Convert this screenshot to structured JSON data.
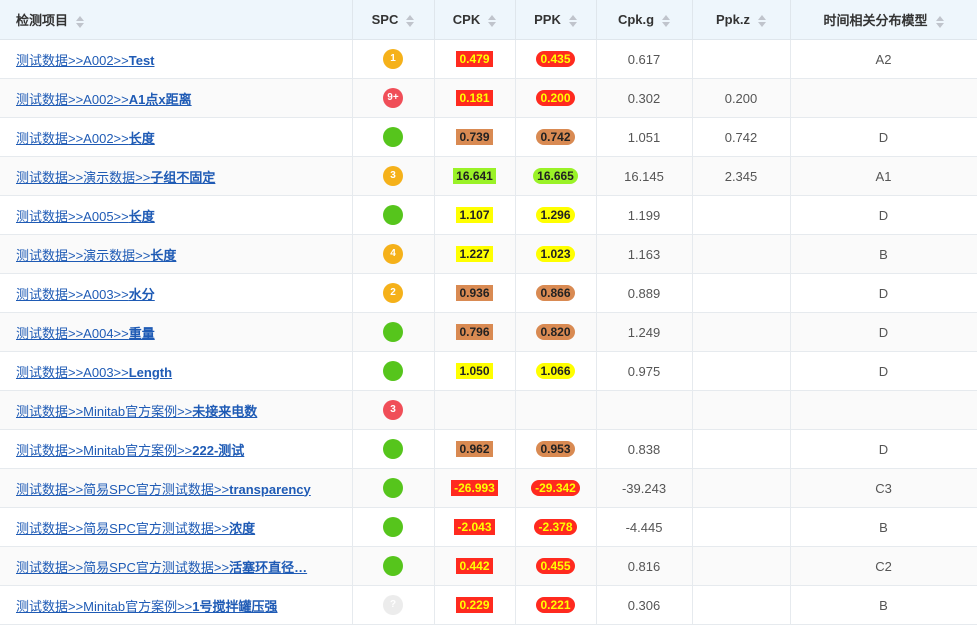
{
  "colors": {
    "red": "#ff2a1f",
    "orange": "#d98a52",
    "yellow": "#ffff00",
    "green": "#9af227",
    "dot_orange": "#f5b11a",
    "dot_red": "#f04e58",
    "dot_green": "#56c51c",
    "dot_gray": "#ececec"
  },
  "headers": [
    "检测项目",
    "SPC",
    "CPK",
    "PPK",
    "Cpk.g",
    "Ppk.z",
    "时间相关分布模型"
  ],
  "rows": [
    {
      "prefix": "测试数据>>A002>>",
      "bold": "Test",
      "spc": {
        "kind": "orange",
        "label": "1"
      },
      "cpk": {
        "v": "0.479",
        "c": "red"
      },
      "ppk": {
        "v": "0.435",
        "c": "red"
      },
      "cpkg": "0.617",
      "ppkz": "",
      "model": "A2"
    },
    {
      "prefix": "测试数据>>A002>>",
      "bold": "A1点x距离",
      "spc": {
        "kind": "red",
        "label": "9+"
      },
      "cpk": {
        "v": "0.181",
        "c": "red"
      },
      "ppk": {
        "v": "0.200",
        "c": "red"
      },
      "cpkg": "0.302",
      "ppkz": "0.200",
      "model": ""
    },
    {
      "prefix": "测试数据>>A002>>",
      "bold": "长度",
      "spc": {
        "kind": "green",
        "label": ""
      },
      "cpk": {
        "v": "0.739",
        "c": "orange"
      },
      "ppk": {
        "v": "0.742",
        "c": "orange"
      },
      "cpkg": "1.051",
      "ppkz": "0.742",
      "model": "D"
    },
    {
      "prefix": "测试数据>>演示数据>>",
      "bold": "子组不固定",
      "spc": {
        "kind": "orange",
        "label": "3"
      },
      "cpk": {
        "v": "16.641",
        "c": "green"
      },
      "ppk": {
        "v": "16.665",
        "c": "green"
      },
      "cpkg": "16.145",
      "ppkz": "2.345",
      "model": "A1"
    },
    {
      "prefix": "测试数据>>A005>>",
      "bold": "长度",
      "spc": {
        "kind": "green",
        "label": ""
      },
      "cpk": {
        "v": "1.107",
        "c": "yellow"
      },
      "ppk": {
        "v": "1.296",
        "c": "yellow"
      },
      "cpkg": "1.199",
      "ppkz": "",
      "model": "D"
    },
    {
      "prefix": "测试数据>>演示数据>>",
      "bold": "长度",
      "spc": {
        "kind": "orange",
        "label": "4"
      },
      "cpk": {
        "v": "1.227",
        "c": "yellow"
      },
      "ppk": {
        "v": "1.023",
        "c": "yellow"
      },
      "cpkg": "1.163",
      "ppkz": "",
      "model": "B"
    },
    {
      "prefix": "测试数据>>A003>>",
      "bold": "水分",
      "spc": {
        "kind": "orange",
        "label": "2"
      },
      "cpk": {
        "v": "0.936",
        "c": "orange"
      },
      "ppk": {
        "v": "0.866",
        "c": "orange"
      },
      "cpkg": "0.889",
      "ppkz": "",
      "model": "D"
    },
    {
      "prefix": "测试数据>>A004>>",
      "bold": "重量",
      "spc": {
        "kind": "green",
        "label": ""
      },
      "cpk": {
        "v": "0.796",
        "c": "orange"
      },
      "ppk": {
        "v": "0.820",
        "c": "orange"
      },
      "cpkg": "1.249",
      "ppkz": "",
      "model": "D"
    },
    {
      "prefix": "测试数据>>A003>>",
      "bold": "Length",
      "spc": {
        "kind": "green",
        "label": ""
      },
      "cpk": {
        "v": "1.050",
        "c": "yellow"
      },
      "ppk": {
        "v": "1.066",
        "c": "yellow"
      },
      "cpkg": "0.975",
      "ppkz": "",
      "model": "D"
    },
    {
      "prefix": "测试数据>>Minitab官方案例>>",
      "bold": "未接来电数",
      "spc": {
        "kind": "red",
        "label": "3"
      },
      "cpk": {
        "v": "",
        "c": ""
      },
      "ppk": {
        "v": "",
        "c": ""
      },
      "cpkg": "",
      "ppkz": "",
      "model": ""
    },
    {
      "prefix": "测试数据>>Minitab官方案例>>",
      "bold": "222-测试",
      "spc": {
        "kind": "green",
        "label": ""
      },
      "cpk": {
        "v": "0.962",
        "c": "orange"
      },
      "ppk": {
        "v": "0.953",
        "c": "orange"
      },
      "cpkg": "0.838",
      "ppkz": "",
      "model": "D"
    },
    {
      "prefix": "测试数据>>简易SPC官方测试数据>>",
      "bold": "transparency",
      "spc": {
        "kind": "green",
        "label": ""
      },
      "cpk": {
        "v": "-26.993",
        "c": "red"
      },
      "ppk": {
        "v": "-29.342",
        "c": "red"
      },
      "cpkg": "-39.243",
      "ppkz": "",
      "model": "C3"
    },
    {
      "prefix": "测试数据>>简易SPC官方测试数据>>",
      "bold": "浓度",
      "spc": {
        "kind": "green",
        "label": ""
      },
      "cpk": {
        "v": "-2.043",
        "c": "red"
      },
      "ppk": {
        "v": "-2.378",
        "c": "red"
      },
      "cpkg": "-4.445",
      "ppkz": "",
      "model": "B"
    },
    {
      "prefix": "测试数据>>简易SPC官方测试数据>>",
      "bold": "活塞环直径…",
      "spc": {
        "kind": "green",
        "label": ""
      },
      "cpk": {
        "v": "0.442",
        "c": "red"
      },
      "ppk": {
        "v": "0.455",
        "c": "red"
      },
      "cpkg": "0.816",
      "ppkz": "",
      "model": "C2"
    },
    {
      "prefix": "测试数据>>Minitab官方案例>>",
      "bold": "1号搅拌罐压强",
      "spc": {
        "kind": "gray",
        "label": "?"
      },
      "cpk": {
        "v": "0.229",
        "c": "red"
      },
      "ppk": {
        "v": "0.221",
        "c": "red"
      },
      "cpkg": "0.306",
      "ppkz": "",
      "model": "B"
    }
  ]
}
